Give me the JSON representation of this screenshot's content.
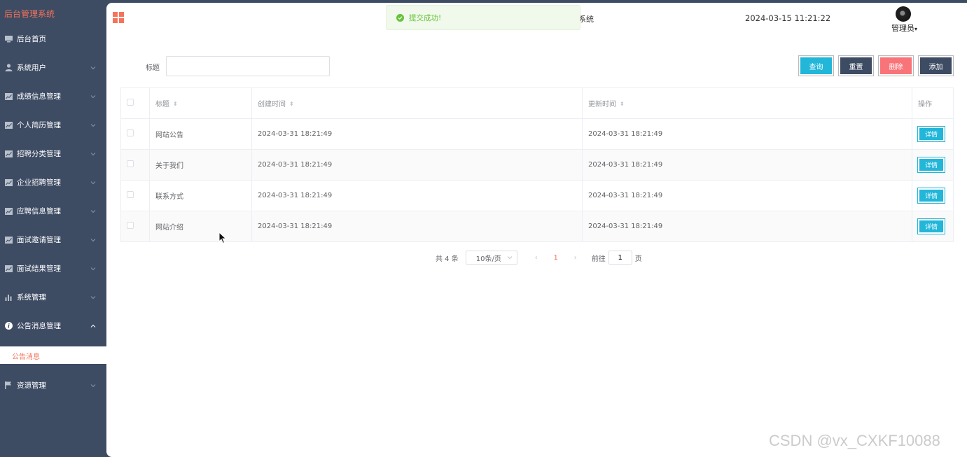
{
  "app": {
    "brand": "后台管理系统"
  },
  "sidebar": {
    "items": [
      {
        "label": "后台首页",
        "icon": "monitor-icon",
        "chevron": false
      },
      {
        "label": "系统用户",
        "icon": "user-icon",
        "chevron": true
      },
      {
        "label": "成绩信息管理",
        "icon": "chart-icon",
        "chevron": true
      },
      {
        "label": "个人简历管理",
        "icon": "chart-icon",
        "chevron": true
      },
      {
        "label": "招聘分类管理",
        "icon": "chart-icon",
        "chevron": true
      },
      {
        "label": "企业招聘管理",
        "icon": "chart-icon",
        "chevron": true
      },
      {
        "label": "应聘信息管理",
        "icon": "chart-icon",
        "chevron": true
      },
      {
        "label": "面试邀请管理",
        "icon": "chart-icon",
        "chevron": true
      },
      {
        "label": "面试结果管理",
        "icon": "chart-icon",
        "chevron": true
      },
      {
        "label": "系统管理",
        "icon": "bar-chart-icon",
        "chevron": true
      },
      {
        "label": "公告消息管理",
        "icon": "info-icon",
        "chevron": true,
        "expanded": true
      }
    ],
    "sub_item": "公告消息",
    "bottom_item": {
      "label": "资源管理",
      "icon": "flag-icon"
    }
  },
  "header": {
    "sys_title": "系统",
    "datetime": "2024-03-15 11:21:22",
    "user": "管理员"
  },
  "toast": {
    "text": "提交成功!"
  },
  "search": {
    "label": "标题",
    "value": "",
    "placeholder": ""
  },
  "buttons": {
    "query": "查询",
    "reset": "重置",
    "delete": "删除",
    "add": "添加"
  },
  "table": {
    "headers": {
      "title": "标题",
      "created": "创建时间",
      "updated": "更新时间",
      "ops": "操作"
    },
    "rows": [
      {
        "title": "网站公告",
        "created": "2024-03-31 18:21:49",
        "updated": "2024-03-31 18:21:49",
        "action": "详情"
      },
      {
        "title": "关于我们",
        "created": "2024-03-31 18:21:49",
        "updated": "2024-03-31 18:21:49",
        "action": "详情"
      },
      {
        "title": "联系方式",
        "created": "2024-03-31 18:21:49",
        "updated": "2024-03-31 18:21:49",
        "action": "详情"
      },
      {
        "title": "网站介绍",
        "created": "2024-03-31 18:21:49",
        "updated": "2024-03-31 18:21:49",
        "action": "详情"
      }
    ]
  },
  "pagination": {
    "total": "共 4 条",
    "page_size": "10条/页",
    "current": "1",
    "goto_label": "前往",
    "goto_value": "1",
    "page_unit": "页"
  },
  "watermark": "CSDN @vx_CXKF10088",
  "colors": {
    "sidebar": "#3d4b63",
    "accent": "#f5735b",
    "query": "#22b6d9",
    "delete": "#f97479",
    "success": "#67c23a"
  }
}
